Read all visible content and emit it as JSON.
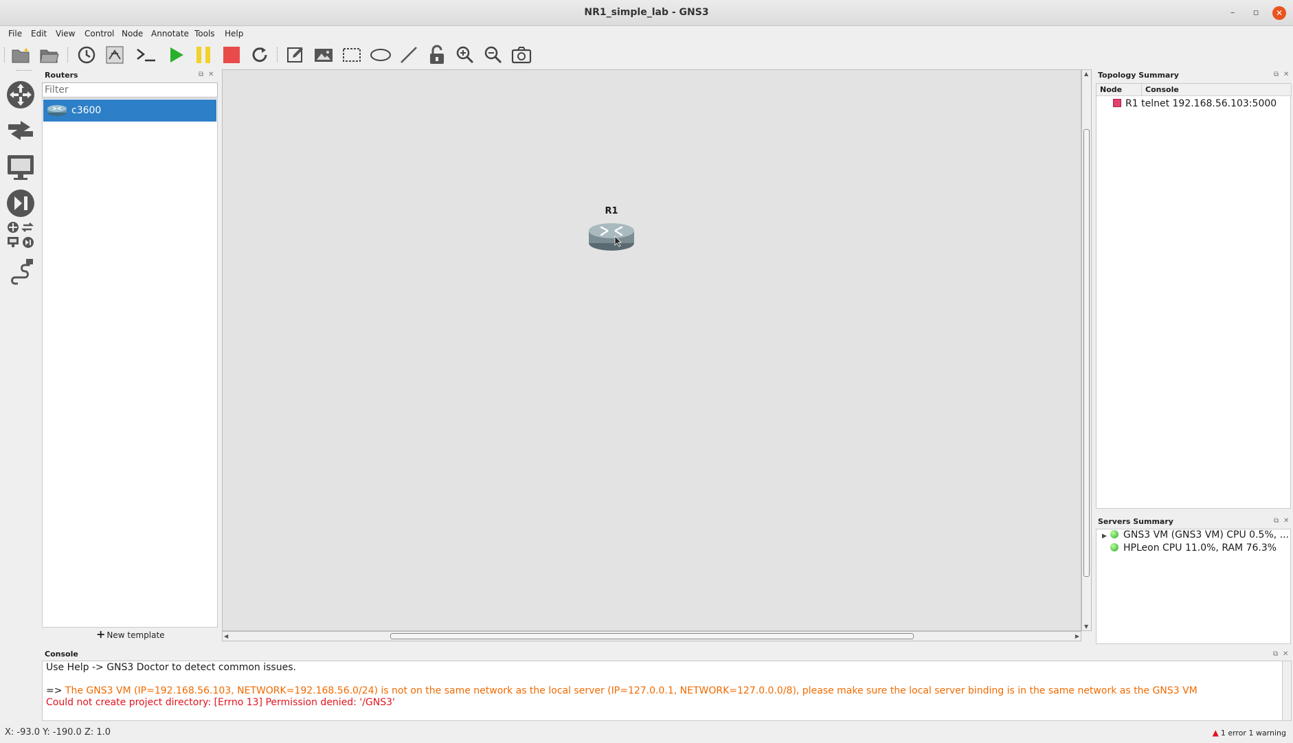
{
  "window": {
    "title": "NR1_simple_lab - GNS3"
  },
  "menu": [
    "File",
    "Edit",
    "View",
    "Control",
    "Node",
    "Annotate",
    "Tools",
    "Help"
  ],
  "toolbar_icons": [
    "new-project-icon",
    "open-project-icon",
    "snapshot-icon",
    "show-interface-labels-icon",
    "console-all-icon",
    "start-all-icon",
    "suspend-all-icon",
    "stop-all-icon",
    "reload-all-icon",
    "add-note-icon",
    "insert-picture-icon",
    "draw-rectangle-icon",
    "draw-ellipse-icon",
    "draw-line-icon",
    "lock-unlock-icon",
    "zoom-in-icon",
    "zoom-out-icon",
    "screenshot-icon"
  ],
  "routers_panel": {
    "title": "Routers",
    "filter_placeholder": "Filter",
    "items": [
      {
        "label": "c3600"
      }
    ],
    "new_template_label": "New template"
  },
  "canvas": {
    "nodes": [
      {
        "label": "R1",
        "icon": "router-icon"
      }
    ]
  },
  "topology_summary": {
    "title": "Topology Summary",
    "columns": [
      "Node",
      "Console"
    ],
    "rows": [
      {
        "node": "R1",
        "console": "telnet 192.168.56.103:5000",
        "status_color": "#e3416d"
      }
    ]
  },
  "servers_summary": {
    "title": "Servers Summary",
    "servers": [
      {
        "text": "GNS3 VM (GNS3 VM) CPU 0.5%, ...",
        "status_color": "#2da52d"
      },
      {
        "text": "HPLeon CPU 11.0%, RAM 76.3%",
        "status_color": "#2da52d"
      }
    ]
  },
  "console": {
    "title": "Console",
    "lines": [
      {
        "text": "Use Help -> GNS3 Doctor to detect common issues."
      },
      {
        "prefix": "=>",
        "text": "The GNS3 VM (IP=192.168.56.103, NETWORK=192.168.56.0/24) is not on the same network as the local server (IP=127.0.0.1, NETWORK=127.0.0.0/8), please make sure the local server binding is in the same network as the GNS3 VM"
      },
      {
        "text": "Could not create project directory: [Errno 13] Permission denied: '/GNS3'"
      }
    ],
    "colors": {
      "warning": "#f06a00",
      "error": "#e0141e"
    }
  },
  "status_bar": {
    "coords": "X: -93.0 Y: -190.0 Z: 1.0",
    "issues": "1 error 1 warning"
  },
  "colors": {
    "selection": "#2d7fc7",
    "start": "#2bb02b",
    "pause": "#f2d12a",
    "stop": "#e94b4b"
  }
}
